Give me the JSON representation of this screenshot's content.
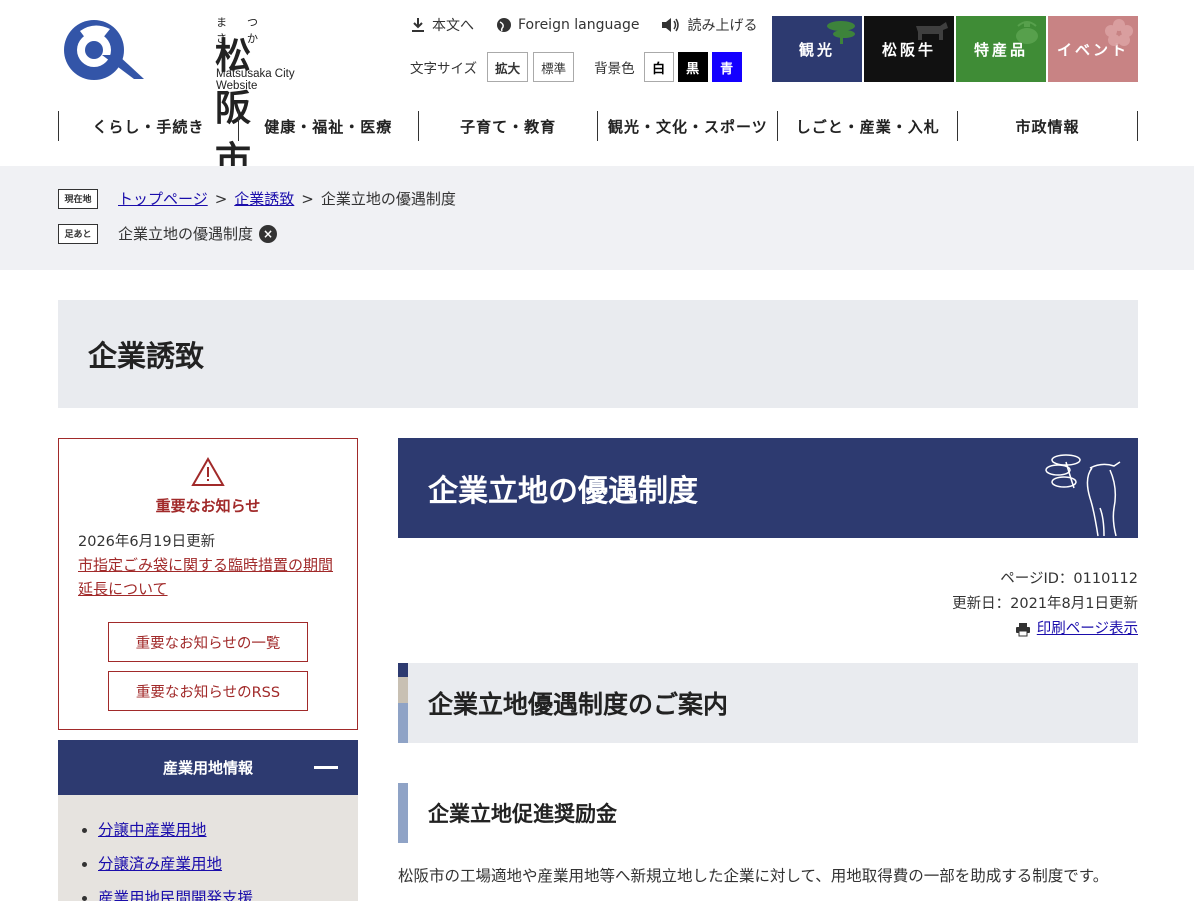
{
  "logo": {
    "ruby": "まつ さか",
    "name": "松阪市",
    "subtitle": "Matsusaka City Website"
  },
  "utility": {
    "skip": "本文へ",
    "foreign": "Foreign language",
    "read": "読み上げる",
    "text_size_label": "文字サイズ",
    "enlarge": "拡大",
    "standard": "標準",
    "bg_label": "背景色",
    "bg_white": "白",
    "bg_black": "黒",
    "bg_blue": "青"
  },
  "tiles": [
    {
      "label": "観光",
      "color": "#2d3a70"
    },
    {
      "label": "松阪牛",
      "color": "#111111"
    },
    {
      "label": "特産品",
      "color": "#3f8c36"
    },
    {
      "label": "イベント",
      "color": "#c88384"
    }
  ],
  "gnav": [
    "くらし・手続き",
    "健康・福祉・医療",
    "子育て・教育",
    "観光・文化・スポーツ",
    "しごと・産業・入札",
    "市政情報"
  ],
  "breadcrumb": {
    "current_tag": "現在地",
    "items": [
      "トップページ",
      "企業誘致",
      "企業立地の優遇制度"
    ],
    "history_tag": "足あと",
    "history_item": "企業立地の優遇制度"
  },
  "section_title": "企業誘致",
  "notice": {
    "title": "重要なお知らせ",
    "date": "2026年6月19日更新",
    "link": "市指定ごみ袋に関する臨時措置の期間延長について",
    "list_button": "重要なお知らせの一覧",
    "rss_button": "重要なお知らせのRSS"
  },
  "sidenav": {
    "heading": "産業用地情報",
    "items": [
      "分譲中産業用地",
      "分譲済み産業用地",
      "産業用地民間開発支援"
    ]
  },
  "page": {
    "title": "企業立地の優遇制度",
    "page_id": "ページID：0110112",
    "updated": "更新日：2021年8月1日更新",
    "print": "印刷ページ表示",
    "h2": "企業立地優遇制度のご案内",
    "h3": "企業立地促進奨励金",
    "body": "松阪市の工場適地や産業用地等へ新規立地した企業に対して、用地取得費の一部を助成する制度です。"
  },
  "colors": {
    "brand": "#2d3a70",
    "notice": "#a12a2a"
  }
}
